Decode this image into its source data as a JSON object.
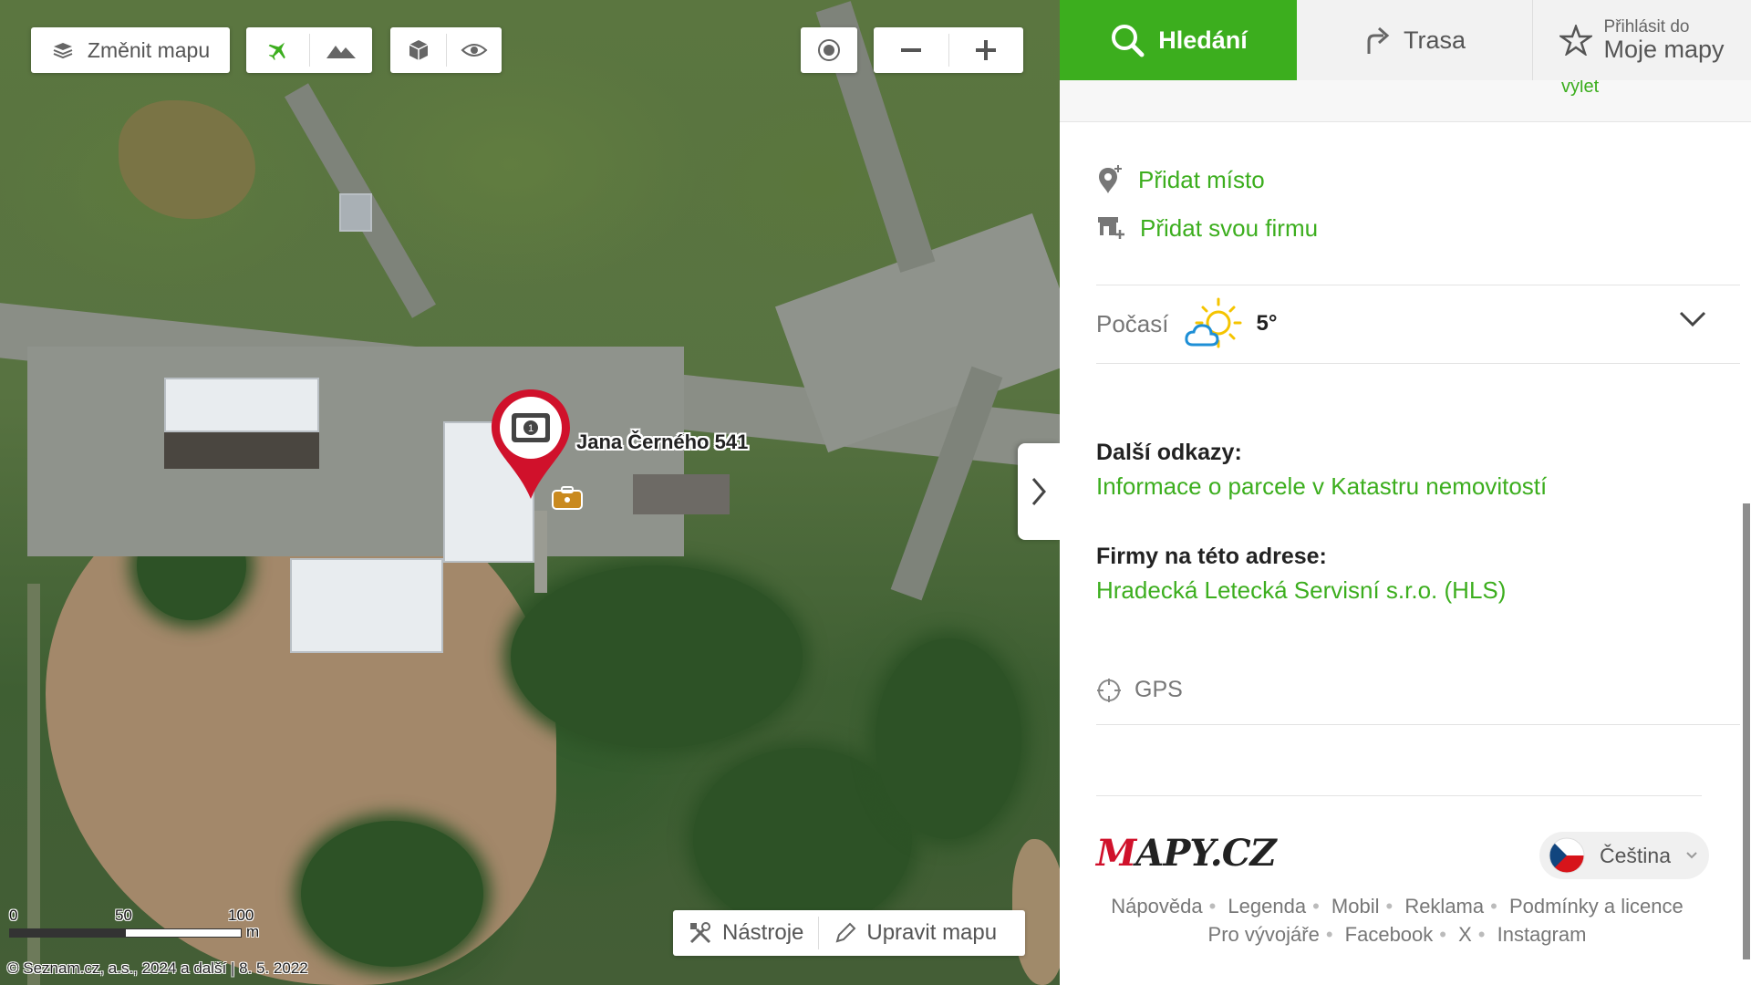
{
  "map": {
    "toolbar": {
      "change_map_label": "Změnit mapu"
    },
    "marker": {
      "address_label": "Jana Černého 541"
    },
    "scale": {
      "labels": [
        "0",
        "50",
        "100"
      ],
      "unit": "m"
    },
    "copyright": "© Seznam.cz, a.s., 2024 a další | 8. 5. 2022",
    "bottom_tools": {
      "tools_label": "Nástroje",
      "edit_label": "Upravit mapu"
    }
  },
  "panel": {
    "tabs": {
      "search_label": "Hledání",
      "route_label": "Trasa",
      "login_small": "Přihlásit do",
      "login_big": "Moje mapy"
    },
    "scroll_hint": "výlet",
    "actions": {
      "add_place": "Přidat místo",
      "add_company": "Přidat svou firmu"
    },
    "weather": {
      "label": "Počasí",
      "temperature": "5°"
    },
    "more_links": {
      "title": "Další odkazy:",
      "cadastre_link": "Informace o parcele v Katastru nemovitostí"
    },
    "companies": {
      "title": "Firmy na této adrese:",
      "company_link": "Hradecká Letecká Servisní s.r.o. (HLS)"
    },
    "gps_label": "GPS",
    "language": "Čeština",
    "footer": {
      "row1": [
        "Nápověda",
        "Legenda",
        "Mobil",
        "Reklama",
        "Podmínky a licence"
      ],
      "row2": [
        "Pro vývojáře",
        "Facebook",
        "X",
        "Instagram"
      ]
    }
  },
  "colors": {
    "accent_green": "#3cae1e",
    "marker_red": "#d0112b"
  }
}
